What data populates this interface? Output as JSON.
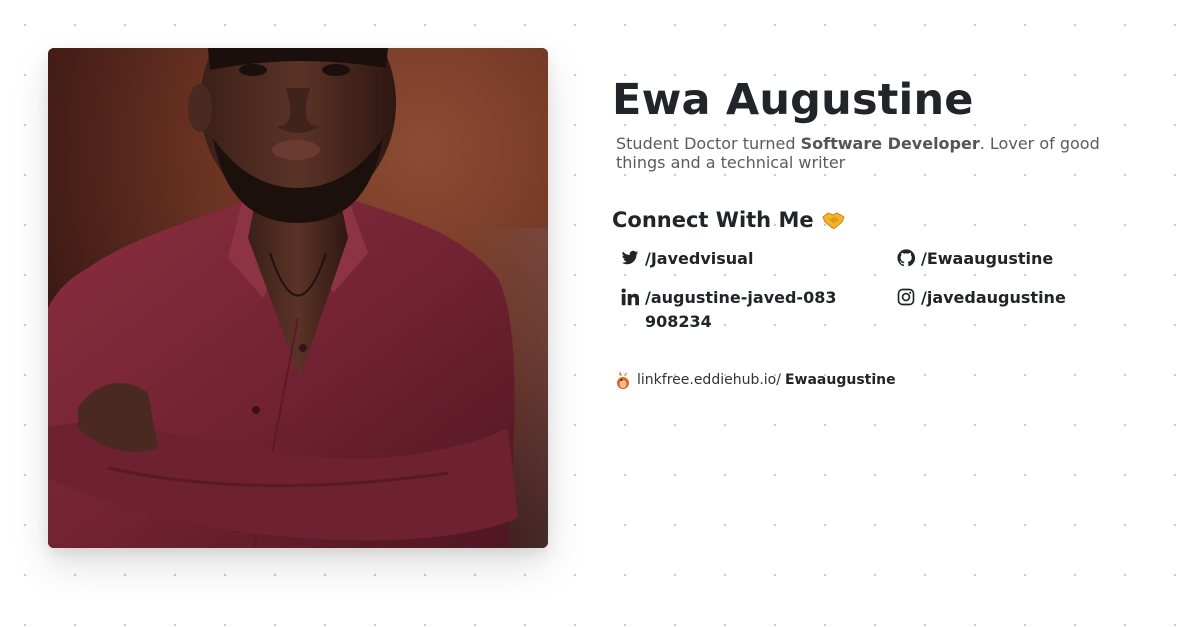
{
  "profile": {
    "name": "Ewa Augustine",
    "photo_icon": "profile-photo",
    "bio": {
      "prefix": "Student Doctor turned ",
      "highlight": "Software Developer",
      "suffix": ". Lover of good things and a technical writer"
    }
  },
  "connect": {
    "heading": "Connect With Me",
    "heading_emoji": "handshake-icon",
    "links": [
      {
        "icon": "twitter-icon",
        "label": "/Javedvisual"
      },
      {
        "icon": "github-icon",
        "label": "/Ewaaugustine"
      },
      {
        "icon": "linkedin-icon",
        "label": "/augustine-javed-083908234"
      },
      {
        "icon": "instagram-icon",
        "label": "/javedaugustine"
      }
    ]
  },
  "linkfree": {
    "icon": "linkfree-logo-icon",
    "domain": "linkfree.eddiehub.io/",
    "username": "Ewaaugustine"
  },
  "colors": {
    "text": "#212529",
    "muted": "#5b5b5b",
    "background": "#ffffff",
    "shirt": "#7a2638"
  }
}
